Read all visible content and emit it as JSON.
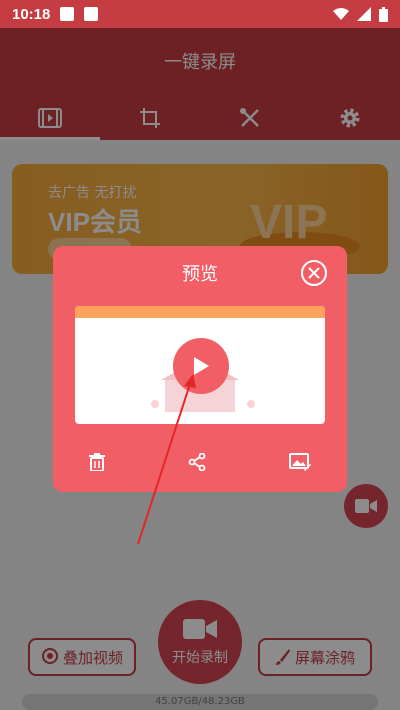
{
  "status": {
    "time": "10:18"
  },
  "header": {
    "title": "一键录屏"
  },
  "tabs": [
    {
      "icon": "video-list-icon"
    },
    {
      "icon": "crop-icon"
    },
    {
      "icon": "tools-icon"
    },
    {
      "icon": "gear-icon"
    }
  ],
  "banner": {
    "subtitle": "去广告  无打扰",
    "title": "VIP会员"
  },
  "bottom": {
    "overlay_video": "叠加视频",
    "start_record": "开始录制",
    "screen_doodle": "屏幕涂鸦",
    "storage": "45.07GB/48.23GB"
  },
  "dialog": {
    "title": "预览"
  },
  "colors": {
    "brand": "#c63c43",
    "dialog": "#f15e66",
    "banner": "#f6ab3a"
  }
}
